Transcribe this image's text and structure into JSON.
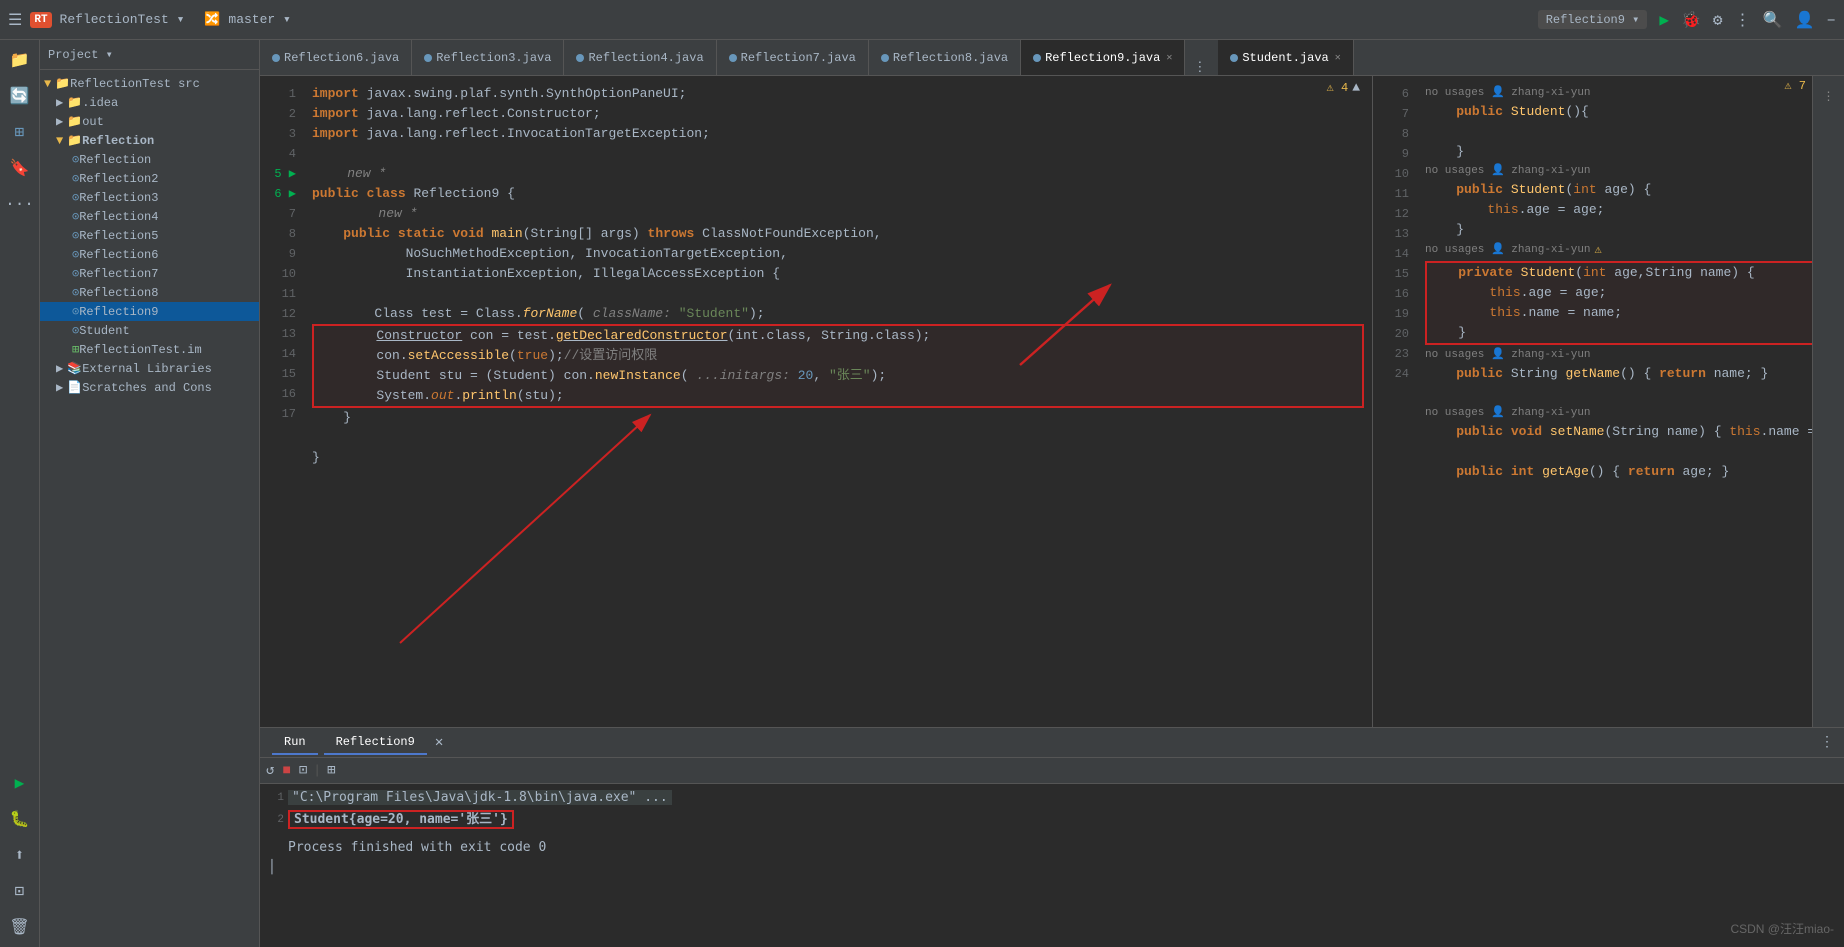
{
  "titleBar": {
    "appLogo": "RT",
    "projectName": "ReflectionTest",
    "vcsBranch": "master",
    "runConfig": "Reflection9",
    "icons": [
      "run",
      "debug",
      "settings",
      "more",
      "minimize"
    ]
  },
  "projectPanel": {
    "header": "Project",
    "tree": [
      {
        "indent": 0,
        "type": "root",
        "label": "ReflectionTest",
        "suffix": "src"
      },
      {
        "indent": 1,
        "type": "folder",
        "label": "idea"
      },
      {
        "indent": 1,
        "type": "folder",
        "label": "out"
      },
      {
        "indent": 1,
        "type": "folder",
        "label": "Reflection",
        "expanded": true
      },
      {
        "indent": 2,
        "type": "java",
        "label": "Reflection"
      },
      {
        "indent": 2,
        "type": "java",
        "label": "Reflection2"
      },
      {
        "indent": 2,
        "type": "java",
        "label": "Reflection3"
      },
      {
        "indent": 2,
        "type": "java",
        "label": "Reflection4"
      },
      {
        "indent": 2,
        "type": "java",
        "label": "Reflection5"
      },
      {
        "indent": 2,
        "type": "java",
        "label": "Reflection6"
      },
      {
        "indent": 2,
        "type": "java",
        "label": "Reflection7"
      },
      {
        "indent": 2,
        "type": "java",
        "label": "Reflection8"
      },
      {
        "indent": 2,
        "type": "java",
        "label": "Reflection9",
        "selected": true
      },
      {
        "indent": 2,
        "type": "java",
        "label": "Student"
      },
      {
        "indent": 2,
        "type": "test",
        "label": "ReflectionTest.im"
      },
      {
        "indent": 1,
        "type": "folder",
        "label": "External Libraries"
      },
      {
        "indent": 1,
        "type": "folder",
        "label": "Scratches and Cons"
      }
    ]
  },
  "tabs": [
    {
      "label": "Reflection6.java",
      "active": false
    },
    {
      "label": "Reflection3.java",
      "active": false
    },
    {
      "label": "Reflection4.java",
      "active": false
    },
    {
      "label": "Reflection7.java",
      "active": false
    },
    {
      "label": "Reflection8.java",
      "active": false
    },
    {
      "label": "Reflection9.java",
      "active": true
    },
    {
      "label": "Student.java",
      "active": true,
      "right": true
    }
  ],
  "reflection9Code": [
    {
      "ln": "1",
      "code": "import javax.swing.plaf.synth.SynthOptionPaneUI;"
    },
    {
      "ln": "2",
      "code": "import java.lang.reflect.Constructor;"
    },
    {
      "ln": "3",
      "code": "import java.lang.reflect.InvocationTargetException;"
    },
    {
      "ln": "4",
      "code": ""
    },
    {
      "ln": "5",
      "code": "    new *",
      "run": true
    },
    {
      "ln": "",
      "code": "public class Reflection9 {"
    },
    {
      "ln": "6",
      "code": "        new *",
      "run": true
    },
    {
      "ln": "",
      "code": "    public static void main(String[] args) throws ClassNotFoundException,"
    },
    {
      "ln": "7",
      "code": "            NoSuchMethodException, InvocationTargetException,"
    },
    {
      "ln": "8",
      "code": "            InstantiationException, IllegalAccessException {"
    },
    {
      "ln": "9",
      "code": ""
    },
    {
      "ln": "10",
      "code": "        Class test = Class.forName( className: \"Student\");",
      "redbox": false
    },
    {
      "ln": "11",
      "code": "        Constructor con = test.getDeclaredConstructor(int.class, String.class);",
      "redbox": true,
      "redstart": true
    },
    {
      "ln": "12",
      "code": "        con.setAccessible(true);//设置访问权限",
      "redbox": true
    },
    {
      "ln": "13",
      "code": "        Student stu = (Student) con.newInstance( ...initargs: 20, \"张三\");",
      "redbox": true
    },
    {
      "ln": "14",
      "code": "        System.out.println(stu);",
      "redbox": true
    },
    {
      "ln": "15",
      "code": "    }",
      "redbox": false,
      "redend": true
    },
    {
      "ln": "16",
      "code": ""
    },
    {
      "ln": "17",
      "code": "}"
    }
  ],
  "studentCode": [
    {
      "ln": "6",
      "hint": "no usages  zhang-xi-yun",
      "code": "    public Student(){"
    },
    {
      "ln": "7",
      "code": ""
    },
    {
      "ln": "8",
      "code": "    }"
    },
    {
      "ln": "",
      "hint": "no usages  zhang-xi-yun"
    },
    {
      "ln": "9",
      "code": "    public Student(int age) {"
    },
    {
      "ln": "10",
      "code": "        this.age = age;"
    },
    {
      "ln": "11",
      "code": "    }"
    },
    {
      "ln": "",
      "hint": "no usages  zhang-xi-yun",
      "warning": true
    },
    {
      "ln": "12",
      "code": "    private Student(int age,String name) {",
      "redbox": true
    },
    {
      "ln": "13",
      "code": "        this.age = age;",
      "redbox": true
    },
    {
      "ln": "14",
      "code": "        this.name = name;",
      "redbox": true
    },
    {
      "ln": "15",
      "code": "    }",
      "redbox": true
    },
    {
      "ln": "",
      "hint": "no usages  zhang-xi-yun"
    },
    {
      "ln": "16",
      "code": "    public String getName() { return name; }"
    },
    {
      "ln": "19",
      "code": ""
    },
    {
      "ln": "",
      "hint": "no usages  zhang-xi-yun"
    },
    {
      "ln": "20",
      "code": "    public void setName(String name) { this.name = n"
    },
    {
      "ln": "23",
      "code": ""
    },
    {
      "ln": "24",
      "code": "    public int getAge() { return age; }"
    }
  ],
  "console": {
    "runLabel": "Run",
    "tabLabel": "Reflection9",
    "lines": [
      {
        "text": "\"C:\\Program Files\\Java\\jdk-1.8\\bin\\java.exe\" ...",
        "type": "path"
      },
      {
        "text": "Student{age=20, name='张三'}",
        "type": "output",
        "highlight": true
      },
      {
        "text": ""
      },
      {
        "text": "Process finished with exit code 0",
        "type": "normal"
      },
      {
        "text": ""
      }
    ]
  },
  "watermark": "CSDN @汪汪miao-"
}
